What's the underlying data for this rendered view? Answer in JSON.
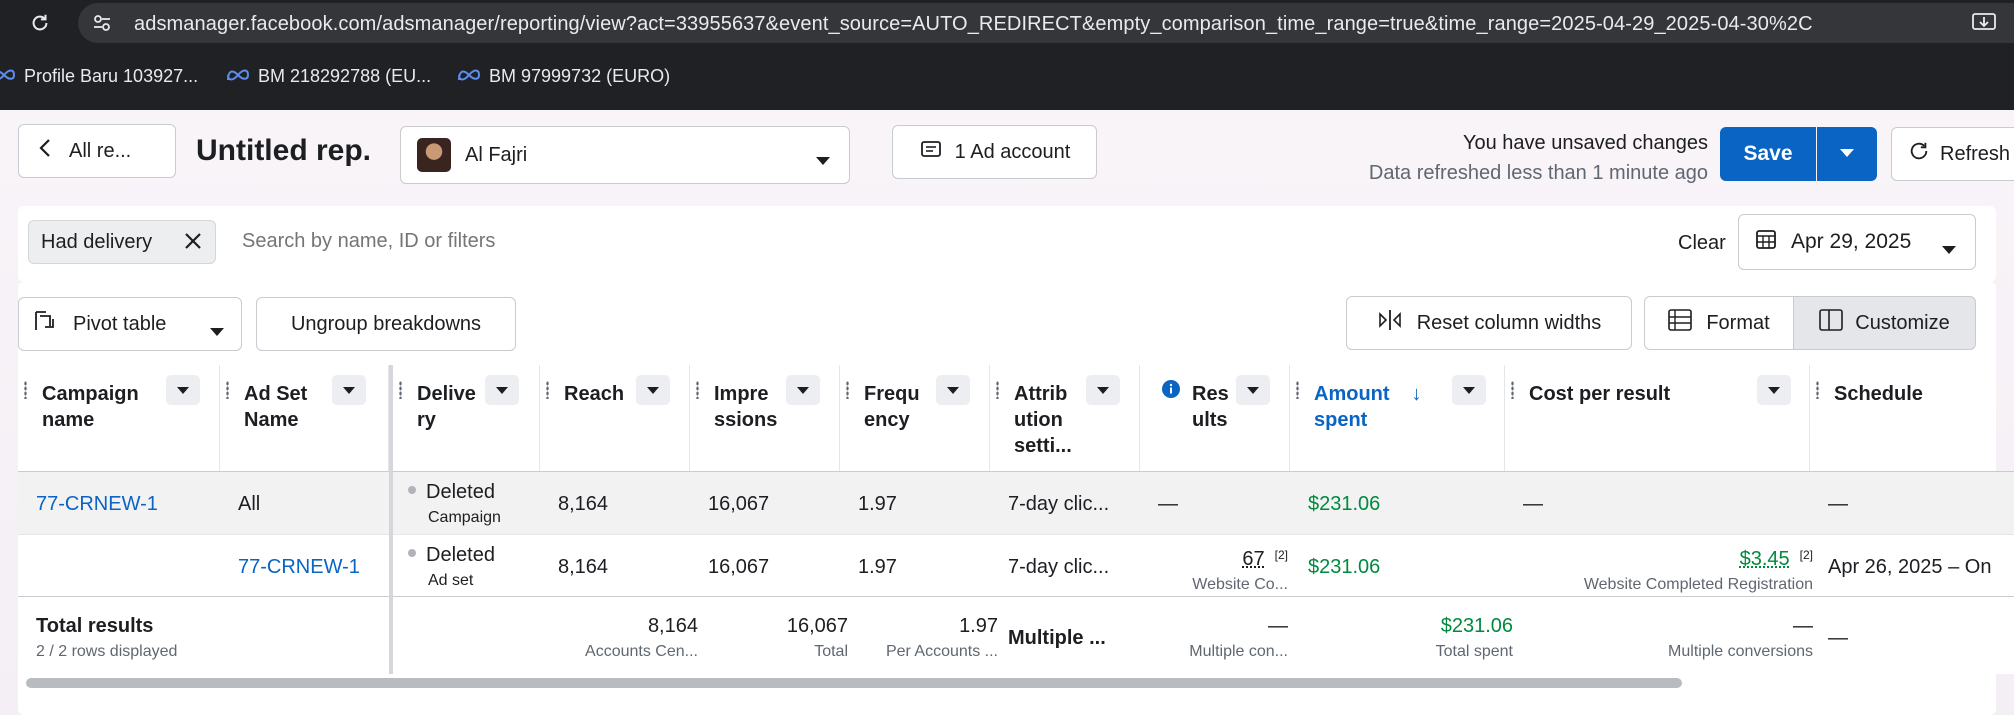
{
  "browser": {
    "url": "adsmanager.facebook.com/adsmanager/reporting/view?act=33955637&event_source=AUTO_REDIRECT&empty_comparison_time_range=true&time_range=2025-04-29_2025-04-30%2C",
    "bookmarks": [
      {
        "label": "Profile Baru 103927..."
      },
      {
        "label": "BM 218292788 (EU..."
      },
      {
        "label": "BM 97999732 (EURO)"
      }
    ]
  },
  "header": {
    "back_label": "All re...",
    "report_title": "Untitled rep.",
    "account_name": "Al Fajri",
    "ad_account_label": "1 Ad account",
    "unsaved_text": "You have unsaved changes",
    "refresh_status": "Data refreshed less than 1 minute ago",
    "save_label": "Save",
    "refresh_label": "Refresh"
  },
  "filters": {
    "chip_label": "Had delivery",
    "search_placeholder": "Search by name, ID or filters",
    "clear_label": "Clear",
    "date_label": "Apr 29, 2025"
  },
  "toolbar": {
    "pivot_label": "Pivot table",
    "ungroup_label": "Ungroup breakdowns",
    "reset_label": "Reset column widths",
    "format_label": "Format",
    "customize_label": "Customize"
  },
  "columns": [
    {
      "l1": "Campaign",
      "l2": "name"
    },
    {
      "l1": "Ad Set",
      "l2": "Name"
    },
    {
      "l1": "Delive",
      "l2": "ry"
    },
    {
      "l1": "Reach",
      "l2": ""
    },
    {
      "l1": "Impre",
      "l2": "ssions"
    },
    {
      "l1": "Frequ",
      "l2": "ency"
    },
    {
      "l1": "Attrib",
      "l2": "ution",
      "l3": "setti..."
    },
    {
      "l1": "Res",
      "l2": "ults"
    },
    {
      "l1": "Amount",
      "l2": "spent",
      "sort": "↓"
    },
    {
      "l1": "Cost per result",
      "l2": ""
    },
    {
      "l1": "Schedule",
      "l2": ""
    }
  ],
  "rows": [
    {
      "campaign": "77-CRNEW-1",
      "adset": "All",
      "delivery": "Deleted",
      "delivery_sub": "Campaign",
      "reach": "8,164",
      "impressions": "16,067",
      "frequency": "1.97",
      "attribution": "7-day clic...",
      "results": "—",
      "amount": "$231.06",
      "cost": "—",
      "schedule": "—"
    },
    {
      "campaign": "",
      "adset": "77-CRNEW-1",
      "delivery": "Deleted",
      "delivery_sub": "Ad set",
      "reach": "8,164",
      "impressions": "16,067",
      "frequency": "1.97",
      "attribution": "7-day clic...",
      "results": "67",
      "results_sup": "[2]",
      "results_sub": "Website Co...",
      "amount": "$231.06",
      "cost": "$3.45",
      "cost_sup": "[2]",
      "cost_sub": "Website Completed Registration",
      "schedule": "Apr 26, 2025 – On"
    }
  ],
  "totals": {
    "label": "Total results",
    "sub": "2 / 2 rows displayed",
    "reach": "8,164",
    "reach_sub": "Accounts Cen...",
    "impressions": "16,067",
    "impressions_sub": "Total",
    "frequency": "1.97",
    "frequency_sub": "Per Accounts ...",
    "attribution": "Multiple ...",
    "results": "—",
    "results_sub": "Multiple con...",
    "amount": "$231.06",
    "amount_sub": "Total spent",
    "cost": "—",
    "cost_sub": "Multiple conversions",
    "schedule": "—"
  },
  "colors": {
    "accent": "#0a64c3",
    "money": "#008a3e"
  }
}
